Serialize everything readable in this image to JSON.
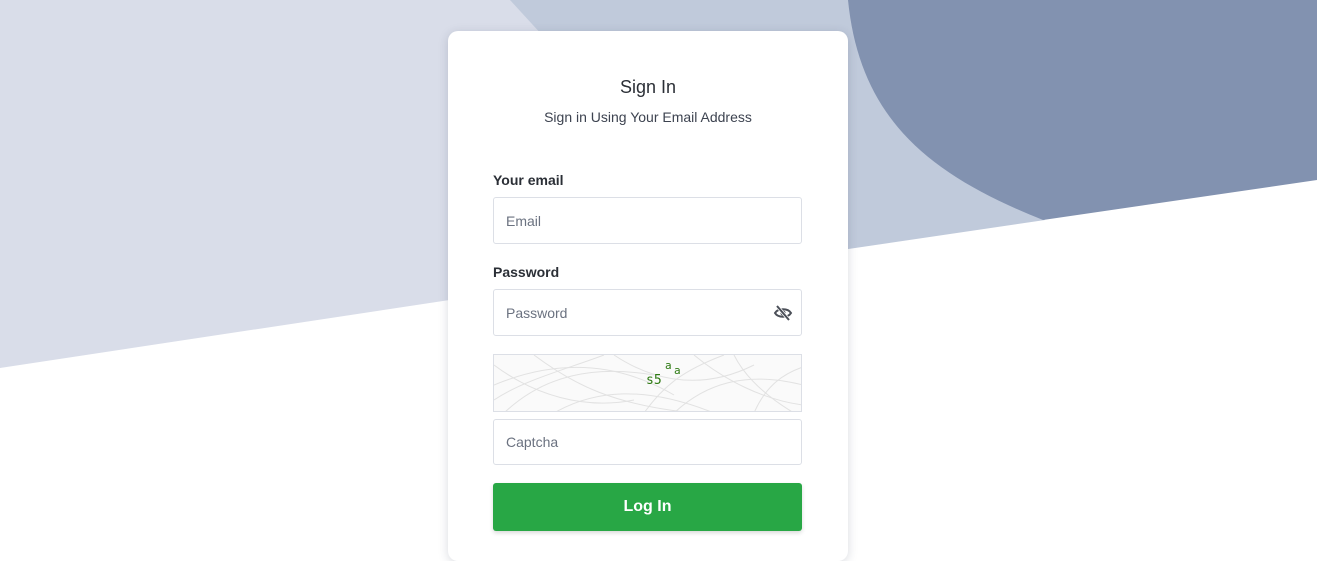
{
  "signin": {
    "title": "Sign In",
    "subtitle": "Sign in Using Your Email Address"
  },
  "form": {
    "email_label": "Your email",
    "email_placeholder": "Email",
    "password_label": "Password",
    "password_placeholder": "Password",
    "captcha_text": "s5aa",
    "captcha_placeholder": "Captcha",
    "login_label": "Log In"
  },
  "colors": {
    "bg_light": "#d9dde9",
    "bg_mid": "#c0cadb",
    "bg_dark": "#8292b0",
    "accent": "#28a745"
  }
}
